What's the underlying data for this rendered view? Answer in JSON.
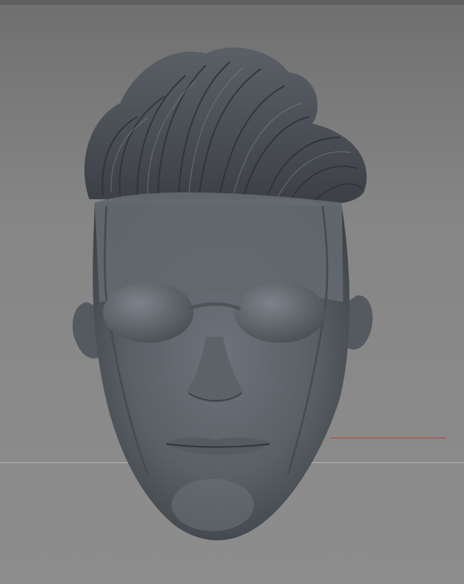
{
  "viewport": {
    "background_top": "#6f6f6f",
    "background_bottom": "#8d8d8d",
    "axis_color": "#c0392b",
    "model_color": "#585d63"
  },
  "model": {
    "icon": "sculpted-head-model-icon"
  }
}
